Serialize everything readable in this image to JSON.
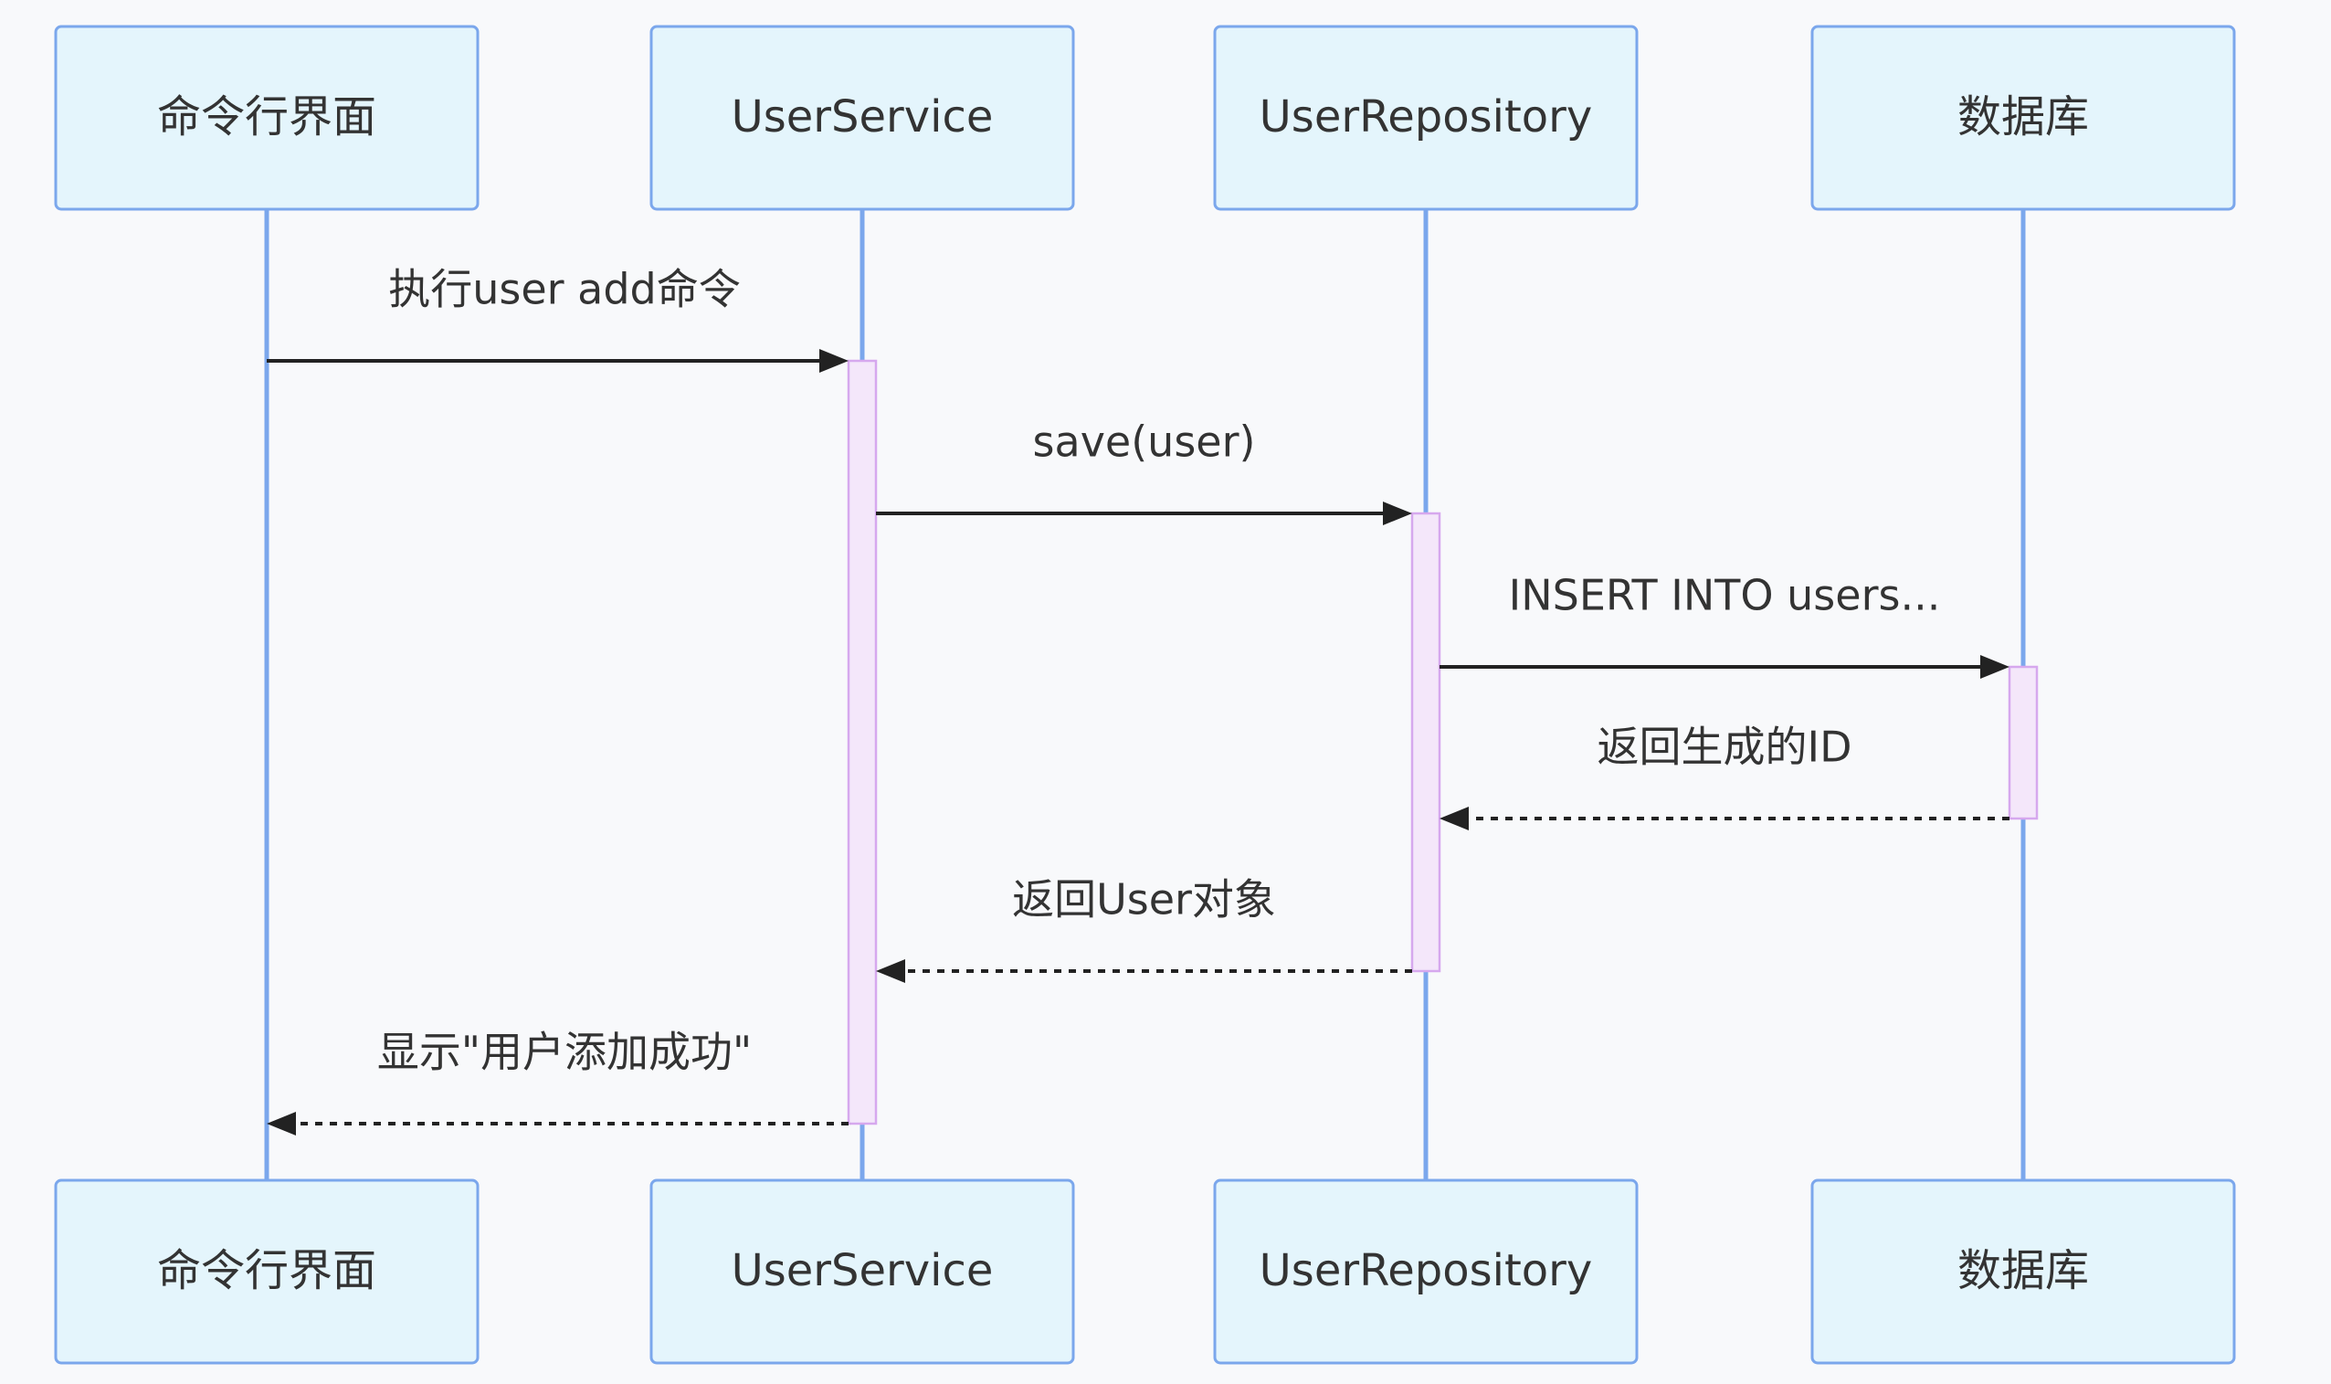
{
  "participants": [
    {
      "id": "cli",
      "label": "命令行界面"
    },
    {
      "id": "svc",
      "label": "UserService"
    },
    {
      "id": "repo",
      "label": "UserRepository"
    },
    {
      "id": "db",
      "label": "数据库"
    }
  ],
  "messages": [
    {
      "from": "cli",
      "to": "svc",
      "label": "执行user add命令",
      "style": "solid"
    },
    {
      "from": "svc",
      "to": "repo",
      "label": "save(user)",
      "style": "solid"
    },
    {
      "from": "repo",
      "to": "db",
      "label": "INSERT INTO users...",
      "style": "solid"
    },
    {
      "from": "db",
      "to": "repo",
      "label": "返回生成的ID",
      "style": "dashed"
    },
    {
      "from": "repo",
      "to": "svc",
      "label": "返回User对象",
      "style": "dashed"
    },
    {
      "from": "svc",
      "to": "cli",
      "label": "显示\"用户添加成功\"",
      "style": "dashed"
    }
  ],
  "colors": {
    "actor_fill": "#e4f5fc",
    "actor_border": "#7ba7ec",
    "lifeline": "#7ba7ec",
    "activation_fill": "#f4e7fa",
    "activation_border": "#d6a8ee",
    "arrow": "#222222",
    "text": "#333333"
  }
}
